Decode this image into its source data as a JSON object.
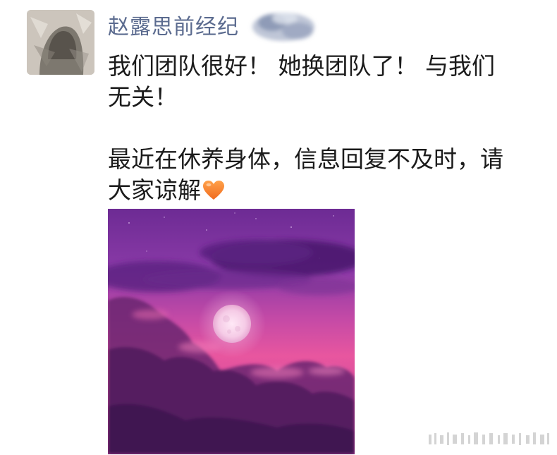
{
  "post": {
    "author": "赵露思前经纪",
    "lines_1": [
      "我们团队很好！ 她换团队了！ 与我们",
      "无关！"
    ],
    "lines_2": [
      "最近在休养身体，信息回复不及时，请",
      "大家谅解"
    ],
    "emoji": "orange-heart-emoji"
  },
  "colors": {
    "author_name": "#5b6b8f",
    "text": "#1b1b1b",
    "sky_purple": "#7a3aa3",
    "sky_pink": "#e2559e",
    "moon": "#f3d6ea"
  },
  "image": {
    "subject": "purple-sky-moon-image"
  }
}
